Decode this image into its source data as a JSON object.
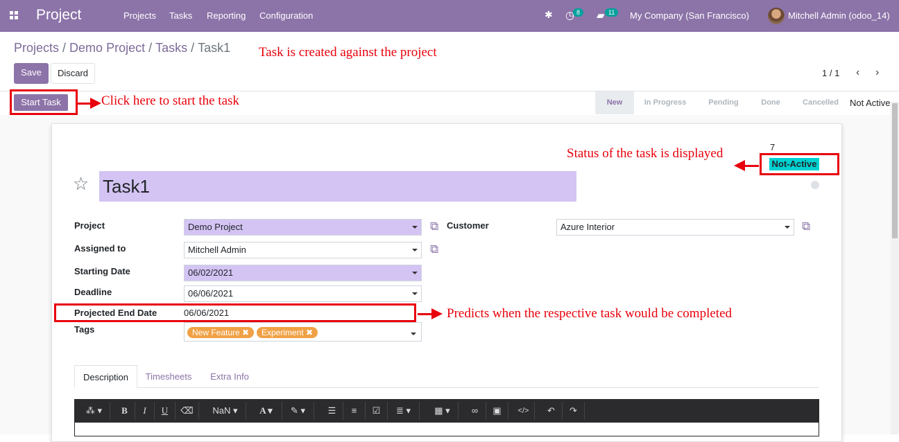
{
  "topbar": {
    "app_title": "Project",
    "menu": [
      "Projects",
      "Tasks",
      "Reporting",
      "Configuration"
    ],
    "activity_badge": "8",
    "messages_badge": "11",
    "company": "My Company (San Francisco)",
    "user": "Mitchell Admin (odoo_14)"
  },
  "breadcrumb": [
    "Projects",
    "Demo Project",
    "Tasks",
    "Task1"
  ],
  "control": {
    "save_label": "Save",
    "discard_label": "Discard",
    "pager": "1 / 1"
  },
  "statusbar": {
    "start_task_label": "Start Task",
    "stages": [
      "New",
      "In Progress",
      "Pending",
      "Done",
      "Cancelled"
    ],
    "active_stage": "New",
    "extra_label": "Not Active"
  },
  "annotations": {
    "created": "Task is created against the project",
    "start": "Click here to start the task",
    "status": "Status of the task is displayed",
    "predict": "Predicts when the respective task would be completed"
  },
  "task": {
    "count": "7",
    "status": "Not-Active",
    "name": "Task1",
    "fields": {
      "project_label": "Project",
      "project": "Demo Project",
      "customer_label": "Customer",
      "customer": "Azure Interior",
      "assigned_label": "Assigned to",
      "assigned": "Mitchell Admin",
      "start_label": "Starting Date",
      "start": "06/02/2021",
      "deadline_label": "Deadline",
      "deadline": "06/06/2021",
      "projected_label": "Projected End Date",
      "projected": "06/06/2021",
      "tags_label": "Tags"
    },
    "tags": [
      "New Feature",
      "Experiment"
    ]
  },
  "tabs": [
    "Description",
    "Timesheets",
    "Extra Info"
  ],
  "editor_toolbar": {
    "font_size": "NaN"
  },
  "colors": {
    "brand": "#8c73a8",
    "annotation": "#e8000b",
    "status_chip": "#00d2d2",
    "tag": "#f0a145"
  }
}
